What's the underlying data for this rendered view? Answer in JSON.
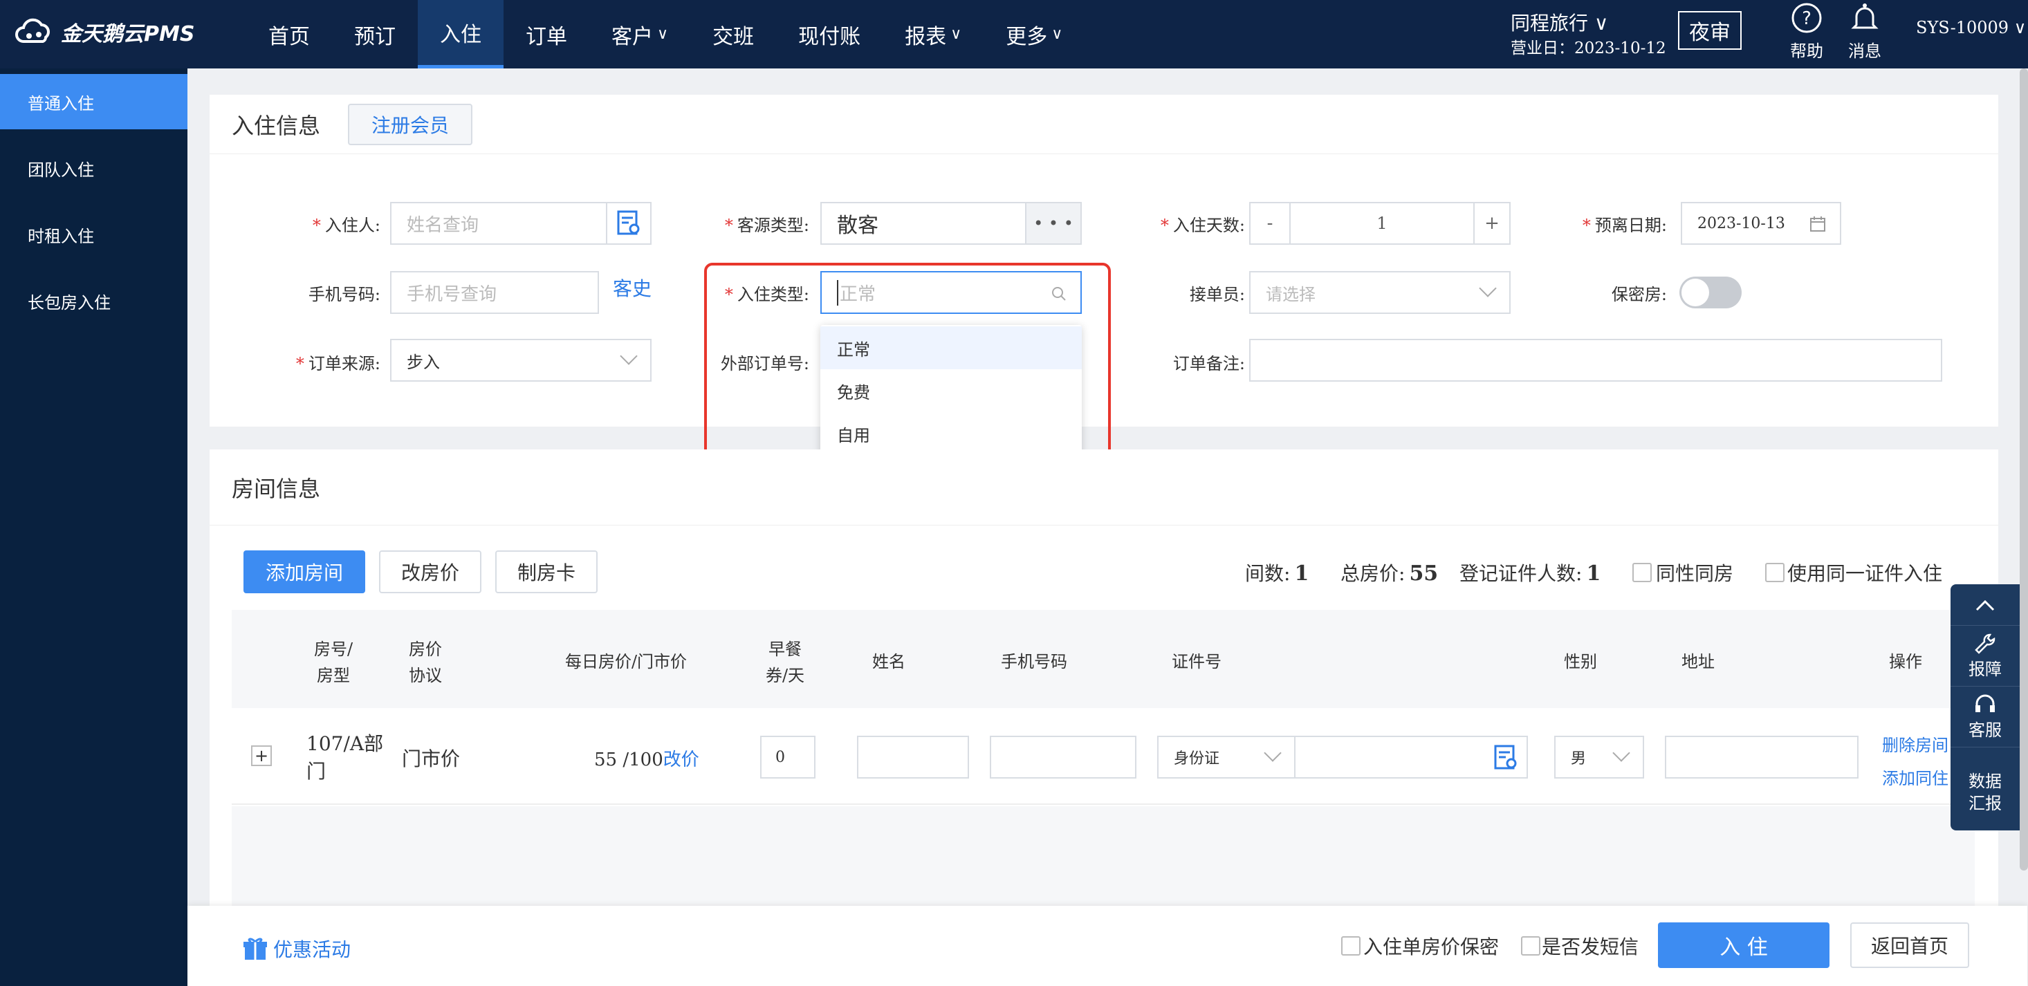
{
  "app": {
    "logo_text": "金天鹅云PMS"
  },
  "nav": [
    {
      "label": "首页",
      "caret": false
    },
    {
      "label": "预订",
      "caret": false
    },
    {
      "label": "入住",
      "caret": false,
      "active": true
    },
    {
      "label": "订单",
      "caret": false
    },
    {
      "label": "客户",
      "caret": true
    },
    {
      "label": "交班",
      "caret": false
    },
    {
      "label": "现付账",
      "caret": false
    },
    {
      "label": "报表",
      "caret": true
    },
    {
      "label": "更多",
      "caret": true
    }
  ],
  "header": {
    "agency": "同程旅行 ∨",
    "business_day": "营业日：2023-10-12",
    "night_audit": "夜审",
    "help": "帮助",
    "messages": "消息",
    "user": "SYS-10009 ∨"
  },
  "sidebar": {
    "items": [
      {
        "label": "普通入住",
        "active": true
      },
      {
        "label": "团队入住"
      },
      {
        "label": "时租入住"
      },
      {
        "label": "长包房入住"
      }
    ]
  },
  "checkin_info": {
    "title": "入住信息",
    "register_member": "注册会员",
    "guest_label": "入住人:",
    "guest_placeholder": "姓名查询",
    "phone_label": "手机号码:",
    "phone_placeholder": "手机号查询",
    "guest_history": "客史",
    "order_source_label": "订单来源:",
    "order_source_value": "步入",
    "source_type_label": "客源类型:",
    "source_type_value": "散客",
    "source_type_more": "• • •",
    "checkin_type_label": "入住类型:",
    "checkin_type_placeholder": "正常",
    "external_order_label": "外部订单号:",
    "days_label": "入住天数:",
    "days_minus": "-",
    "days_value": "1",
    "days_plus": "+",
    "receiver_label": "接单员:",
    "receiver_placeholder": "请选择",
    "remark_label": "订单备注:",
    "departure_label": "预离日期:",
    "departure_value": "2023-10-13",
    "secret_room_label": "保密房:",
    "dropdown_options": [
      "正常",
      "免费",
      "自用"
    ]
  },
  "room_info": {
    "title": "房间信息",
    "add_room": "添加房间",
    "change_price": "改房价",
    "make_card": "制房卡",
    "rooms_label": "间数:",
    "rooms_value": "1",
    "total_price_label": "总房价:",
    "total_price_value": "55",
    "registered_label": "登记证件人数:",
    "registered_value": "1",
    "same_gender": "同性同房",
    "same_id": "使用同一证件入住",
    "columns": {
      "room_no": "房号/",
      "room_type": "房型",
      "price_line1": "房价",
      "price_line2": "协议",
      "daily_price": "每日房价/门市价",
      "breakfast_line1": "早餐",
      "breakfast_line2": "券/天",
      "name": "姓名",
      "phone": "手机号码",
      "id_no": "证件号",
      "gender": "性别",
      "address": "地址",
      "actions": "操作"
    },
    "row": {
      "expand": "+",
      "room_line1": "107/A部",
      "room_line2": "门",
      "price_type": "门市价",
      "daily_price": "55 /100",
      "change_price_link": "改价",
      "breakfast": "0",
      "id_type": "身份证",
      "gender": "男",
      "delete_room": "删除房间",
      "add_cohabitant": "添加同住"
    }
  },
  "footer": {
    "promotions": "优惠活动",
    "price_secret": "入住单房价保密",
    "send_sms": "是否发短信",
    "checkin_button": "入 住",
    "back_home": "返回首页"
  },
  "float_panel": {
    "report_issue": "报障",
    "service": "客服",
    "data_line1": "数据",
    "data_line2": "汇报"
  },
  "colors": {
    "accent": "#3d8cf2",
    "topbar": "#0e2447",
    "sidebar": "#09213f",
    "highlight_box": "#e8362c"
  }
}
